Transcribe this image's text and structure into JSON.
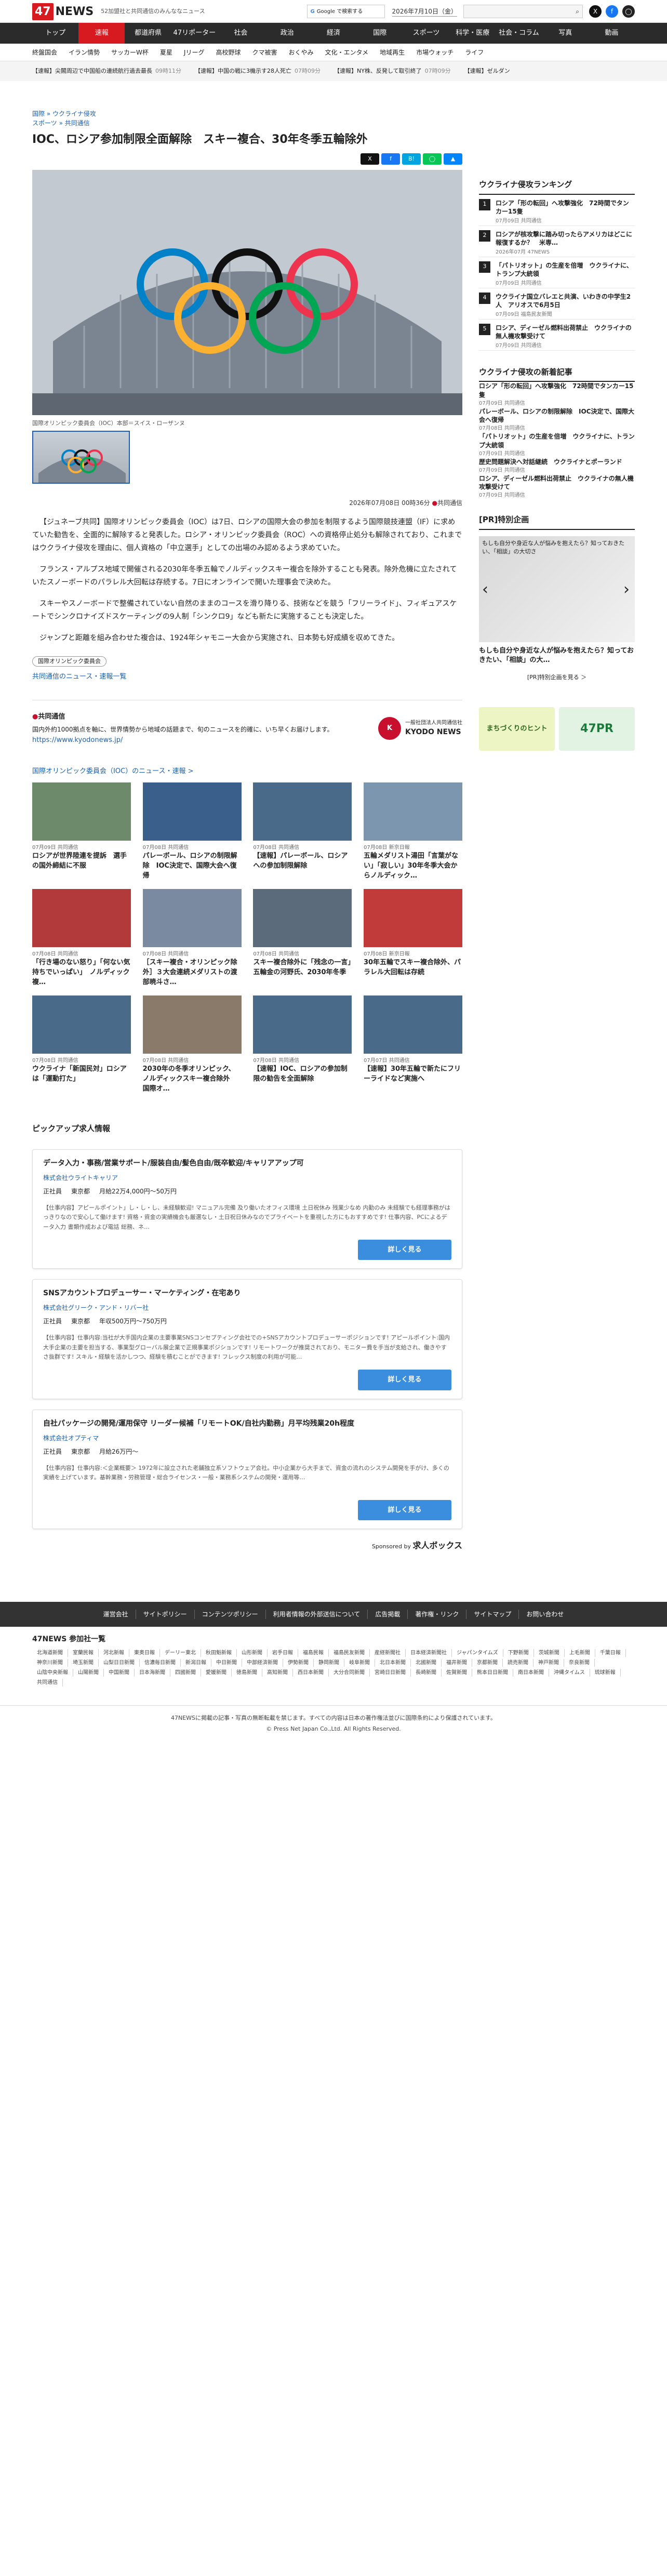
{
  "header": {
    "logo": "47NEWS",
    "tagline": "52加盟社と共同通信のみんななニュース",
    "google_label": "Google で検索する",
    "date": "2026年7月10日（金）",
    "search_placeholder": ""
  },
  "nav": [
    "トップ",
    "速報",
    "都道府県",
    "47リポーターズ",
    "社会",
    "政治",
    "経済",
    "国際",
    "スポーツ",
    "科学・医療",
    "社会・コラム",
    "写真",
    "動画"
  ],
  "nav_active": 1,
  "subnav": [
    "終盤国会",
    "イラン情勢",
    "サッカーW杯",
    "夏星",
    "Jリーグ",
    "高校野球",
    "クマ被害",
    "おくやみ",
    "文化・エンタメ",
    "地域再生",
    "市場ウォッチ",
    "ライフ"
  ],
  "ticker": [
    {
      "t": "【速報】尖閣周辺で中国船の連続航行過去最長",
      "m": "09時11分"
    },
    {
      "t": "【速報】中国の戦に3機示す28人死亡",
      "m": "07時09分"
    },
    {
      "t": "【速報】NY株、反発して取引終了",
      "m": "07時09分"
    },
    {
      "t": "【速報】ゼルダン"
    }
  ],
  "article": {
    "bc1": "国際",
    "bc1b": "ウクライナ侵攻",
    "bc2": "スポーツ",
    "bc2b": "共同通信",
    "title": "IOC、ロシア参加制限全面解除　スキー複合、30年冬季五輪除外",
    "caption": "国際オリンピック委員会（IOC）本部＝スイス・ローザンヌ",
    "date": "2026年07月08日 00時36分",
    "source": "共同通信",
    "paras": [
      "【ジュネーブ共同】国際オリンピック委員会（IOC）は7日、ロシアの国際大会の参加を制限するよう国際競技連盟（IF）に求めていた勧告を、全面的に解除すると発表した。ロシア・オリンピック委員会（ROC）への資格停止処分も解除されており、これまではウクライナ侵攻を理由に、個人資格の「中立選手」としての出場のみ認めるよう求めていた。",
      "フランス・アルプス地域で開催される2030年冬季五輪でノルディックスキー複合を除外することも発表。除外危機に立たされていたスノーボードのパラレル大回転は存続する。7日にオンラインで開いた理事会で決めた。",
      "スキーやスノーボードで整備されていない自然のままのコースを滑り降りる、技術などを競う「フリーライド」、フィギュアスケートでシンクロナイズドスケーティングの9人制「シンクロ9」なども新たに実施することも決定した。",
      "ジャンプと距離を組み合わせた複合は、1924年シャモニー大会から実施され、日本勢も好成績を収めてきた。"
    ],
    "tag": "国際オリンピック委員会",
    "list_link": "共同通信のニュース・速報一覧"
  },
  "kyodo": {
    "title": "共同通信",
    "desc": "国内外約1000拠点を軸に、世界情勢から地域の話題まで、旬のニュースを的確に、いち早くお届けします。",
    "url": "https://www.kyodonews.jp/",
    "logo_ja": "一般社団法人共同通信社",
    "logo_en": "KYODO NEWS"
  },
  "related": {
    "heading": "国際オリンピック委員会（IOC）のニュース・速報 >",
    "items": [
      {
        "d": "07月09日",
        "s": "共同通信",
        "t": "ロシアが世界陸連を提訴　選手の国外締結に不服"
      },
      {
        "d": "07月08日",
        "s": "共同通信",
        "t": "パレーボール、ロシアの制限解除　IOC決定で、国際大会へ復帰"
      },
      {
        "d": "07月08日",
        "s": "共同通信",
        "t": "【速報】パレーボール、ロシアへの参加制限解除"
      },
      {
        "d": "07月08日",
        "s": "新京日報",
        "t": "五輪メダリスト湯田「言葉がない」「寂しい」30年冬季大会からノルディック…"
      },
      {
        "d": "07月08日",
        "s": "共同通信",
        "t": "「行き場のない怒り」「何ない気持ちでいっぱい」　ノルディック複…"
      },
      {
        "d": "07月08日",
        "s": "共同通信",
        "t": "［スキー複合・オリンピック除外］３大会連続メダリストの渡部暁斗さ…"
      },
      {
        "d": "07月08日",
        "s": "共同通信",
        "t": "スキー複合除外に「残念の一言」　五輪金の河野氏、2030年冬季"
      },
      {
        "d": "07月08日",
        "s": "新京日報",
        "t": "30年五輪でスキー複合除外、パラレル大回転は存続"
      },
      {
        "d": "07月08日",
        "s": "共同通信",
        "t": "ウクライナ「新国民対」ロシアは「運動打た」"
      },
      {
        "d": "07月08日",
        "s": "共同通信",
        "t": "2030年の冬季オリンピック、ノルディックスキー複合除外　国際オ…"
      },
      {
        "d": "07月08日",
        "s": "共同通信",
        "t": "【速報】IOC、ロシアの参加制限の勧告を全面解除"
      },
      {
        "d": "07月07日",
        "s": "共同通信",
        "t": "【速報】30年五輪で新たにフリーライドなど実施へ"
      }
    ]
  },
  "jobs": {
    "heading": "ピックアップ求人情報",
    "items": [
      {
        "t": "データ入力・事務/営業サポート/服装自由/髪色自由/既卒歓迎/キャリアアップ可",
        "co": "株式会社ウライトキャリア",
        "type": "正社員",
        "loc": "東京都",
        "pay": "月給22万4,000円〜50万円",
        "desc": "【仕事内容】アピールポイント」し・し・し、未経験歓迎! マニュアル完備 及り働いたオフィス環境 土日祝休み 残業少なめ 内勤のみ 未経験でも経理事務がはっきりなので安心して働けます! 資格・資金の実績機会も厳選なし・土日祝日休みなのでプライベートを重視した方にもおすすめです! 仕事内容、PCによるデータ入力 書類作成および電話 総務、ネ…",
        "btn": "詳しく見る"
      },
      {
        "t": "SNSアカウントプロデューサー・マーケティング・在宅あり",
        "co": "株式会社グリーク・アンド・リバー社",
        "type": "正社員",
        "loc": "東京都",
        "pay": "年収500万円〜750万円",
        "desc": "【仕事内容】仕事内容:当社が大手国内企業の主要事業SNSコンセプティング会社での+SNSアカウントプロデューサーポジションです! アピールポイント:国内大手企業の主要を担当する、事業型グローバル展企業で正規事業ポジションです! リモートワークが推奨されており、モニター費を手当が支給され、働きやすさ抜群です! スキル・経験を活かしつつ、経験を積むことができます! フレックス制度の利用が可能…",
        "btn": "詳しく見る"
      },
      {
        "t": "自社パッケージの開発/運用保守 リーダー候補「リモートOK/自社内勤務」月平均残業20h程度",
        "co": "株式会社オプティマ",
        "type": "正社員",
        "loc": "東京都",
        "pay": "月給26万円〜",
        "desc": "【仕事内容】仕事内容:＜企業概要＞ 1972年に設立された老舗独立系ソフトウェア会社。中小企業から大手まで、資金の流れのシステム開発を手がけ、多くの実績を上げています。基幹業務・労務管理・総合ライセンス・一般・業務系システムの開発・運用等…",
        "btn": "詳しく見る"
      }
    ],
    "sponsor_label": "Sponsored by",
    "sponsor": "求人ボックス"
  },
  "ranking": {
    "title": "ウクライナ侵攻ランキング",
    "items": [
      {
        "t": "ロシア「形の転回」へ攻撃強化　72時間でタンカー15隻",
        "d": "07月09日",
        "s": "共同通信"
      },
      {
        "t": "ロシアが核攻撃に踏み切ったらアメリカはどこに報復するか？　米専…",
        "d": "2026年07月",
        "s": "47NEWS"
      },
      {
        "t": "「パトリオット」の生産を倍増　ウクライナに、トランプ大統領",
        "d": "07月09日",
        "s": "共同通信"
      },
      {
        "t": "ウクライナ国立バレエと共演、いわきの中学生2人　アリオスで6月5日",
        "d": "07月09日",
        "s": "福島民友新聞"
      },
      {
        "t": "ロシア、ディーゼル燃料出荷禁止　ウクライナの無人機攻撃受けて",
        "d": "07月09日",
        "s": "共同通信"
      }
    ]
  },
  "newlist": {
    "title": "ウクライナ侵攻の新着記事",
    "items": [
      {
        "t": "ロシア「形の転回」へ攻撃強化　72時間でタンカー15隻",
        "d": "07月09日",
        "s": "共同通信"
      },
      {
        "t": "パレーボール、ロシアの制限解除　IOC決定で、国際大会へ復帰",
        "d": "07月08日",
        "s": "共同通信"
      },
      {
        "t": "「パトリオット」の生産を倍増　ウクライナに、トランプ大統領",
        "d": "07月09日",
        "s": "共同通信"
      },
      {
        "t": "歴史問題解決へ対話継続　ウクライナとポーランド",
        "d": "07月09日",
        "s": "共同通信"
      },
      {
        "t": "ロシア、ディーゼル燃料出荷禁止　ウクライナの無人機攻撃受けて",
        "d": "07月09日",
        "s": "共同通信"
      }
    ]
  },
  "pr": {
    "title": "[PR]特別企画",
    "img_alt": "もしも自分や身近な人が悩みを抱えたら？知っておきたい、「相談」の大切さ",
    "text": "もしも自分や身近な人が悩みを抱えたら？知っておきたい、「相談」の大…",
    "more": "[PR]特別企画を見る ＞",
    "b1": "まちづくりのヒント",
    "b2": "47PR"
  },
  "footer": {
    "links": [
      "運営会社",
      "サイトポリシー",
      "コンテンツポリシー",
      "利用者情報の外部送信について",
      "広告掲載",
      "著作権・リンク",
      "サイトマップ",
      "お問い合わせ"
    ],
    "pages_title": "47NEWS 参加社一覧",
    "pages": [
      "北海道新聞",
      "室蘭民報",
      "河北新報",
      "東奥日報",
      "デーリー東北",
      "秋田魁新報",
      "山形新聞",
      "岩手日報",
      "福島民報",
      "福島民友新聞",
      "産経新聞社",
      "日本経済新聞社",
      "ジャパンタイムズ",
      "下野新聞",
      "茨城新聞",
      "上毛新聞",
      "千葉日報",
      "神奈川新聞",
      "埼玉新聞",
      "山梨日日新聞",
      "信濃毎日新聞",
      "新潟日報",
      "中日新聞",
      "中部経済新聞",
      "伊勢新聞",
      "静岡新聞",
      "岐阜新聞",
      "北日本新聞",
      "北國新聞",
      "福井新聞",
      "京都新聞",
      "読売新聞",
      "神戸新聞",
      "奈良新聞",
      "山陰中央新報",
      "山陽新聞",
      "中国新聞",
      "日本海新聞",
      "四國新聞",
      "愛媛新聞",
      "徳島新聞",
      "高知新聞",
      "西日本新聞",
      "大分合同新聞",
      "宮崎日日新聞",
      "長崎新聞",
      "佐賀新聞",
      "熊本日日新聞",
      "南日本新聞",
      "沖縄タイムス",
      "琉球新報",
      "共同通信"
    ],
    "copy1": "47NEWSに掲載の記事・写真の無断転載を禁じます。すべての内容は日本の著作権法並びに国際条約により保護されています。",
    "copy2": "© Press Net Japan Co.,Ltd. All Rights Reserved."
  }
}
